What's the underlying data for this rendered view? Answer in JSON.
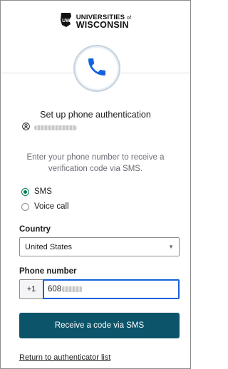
{
  "brand": {
    "line1": "UNIVERSITIES",
    "line1_suffix": "of",
    "line2": "WISCONSIN",
    "logo": "uw-logo-icon"
  },
  "factor_icon": "phone-icon",
  "title": "Set up phone authentication",
  "identifier": {
    "icon": "user-icon"
  },
  "instructions": "Enter your phone number to receive a verification code via SMS.",
  "methods": {
    "sms_label": "SMS",
    "voice_label": "Voice call",
    "selected": "SMS"
  },
  "country": {
    "label": "Country",
    "value": "United States"
  },
  "phone": {
    "label": "Phone number",
    "prefix": "+1",
    "value_visible": "608"
  },
  "submit_label": "Receive a code via SMS",
  "back_link": "Return to authenticator list",
  "colors": {
    "primary_button": "#0c546a",
    "radio_selected": "#00805a",
    "focus_border": "#1662dd",
    "phone_icon": "#1662dd"
  }
}
